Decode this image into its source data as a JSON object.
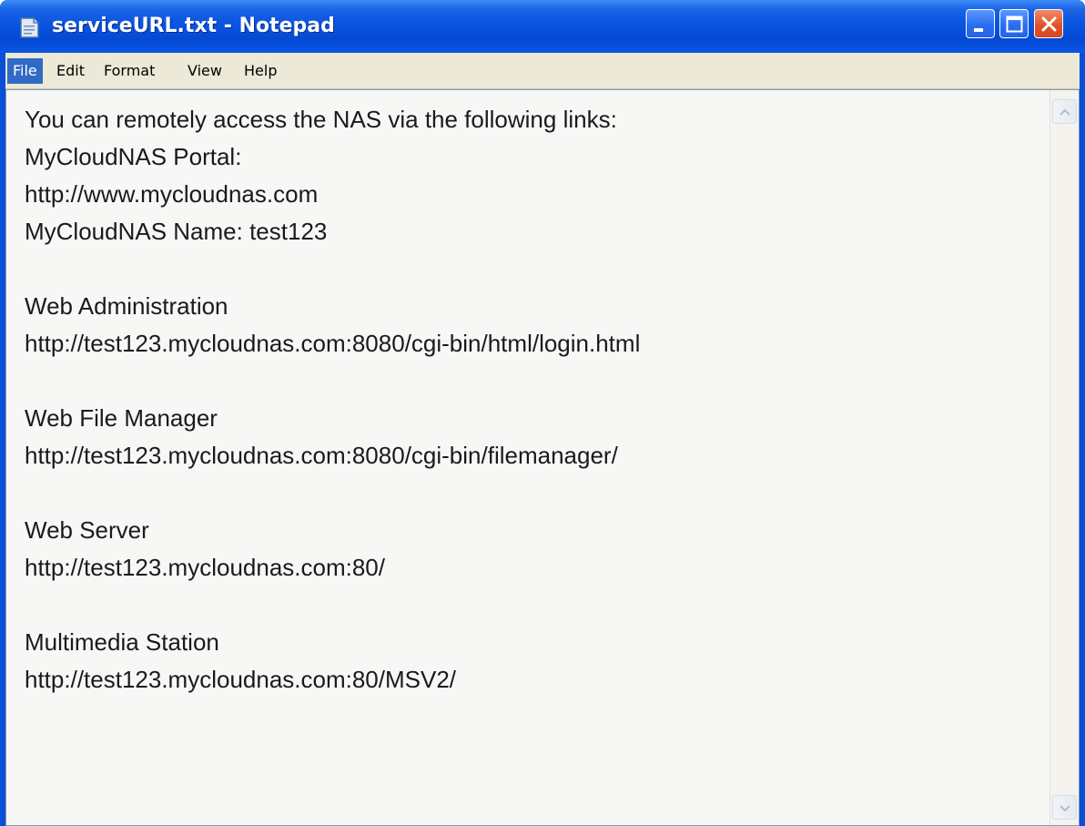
{
  "window": {
    "title": "serviceURL.txt - Notepad",
    "app_icon": "notepad-icon",
    "controls": [
      "minimize-icon",
      "maximize-icon",
      "close-icon"
    ]
  },
  "menu": {
    "items": [
      {
        "label": "File",
        "state": "active"
      },
      {
        "label": "Edit"
      },
      {
        "label": "Format"
      },
      {
        "label": "View"
      },
      {
        "label": "Help"
      }
    ]
  },
  "document": {
    "lines": [
      "You can remotely access the NAS via the following links:",
      "MyCloudNAS Portal:",
      "http://www.mycloudnas.com",
      "MyCloudNAS Name: test123",
      "",
      "Web Administration",
      "http://test123.mycloudnas.com:8080/cgi-bin/html/login.html",
      "",
      "Web File Manager",
      "http://test123.mycloudnas.com:8080/cgi-bin/filemanager/",
      "",
      "Web Server",
      "http://test123.mycloudnas.com:80/",
      "",
      "Multimedia Station",
      "http://test123.mycloudnas.com:80/MSV2/"
    ]
  },
  "colors": {
    "titlebar": "#0a55e0",
    "menu_highlight": "#316ac5",
    "close_button": "#e0542b"
  }
}
